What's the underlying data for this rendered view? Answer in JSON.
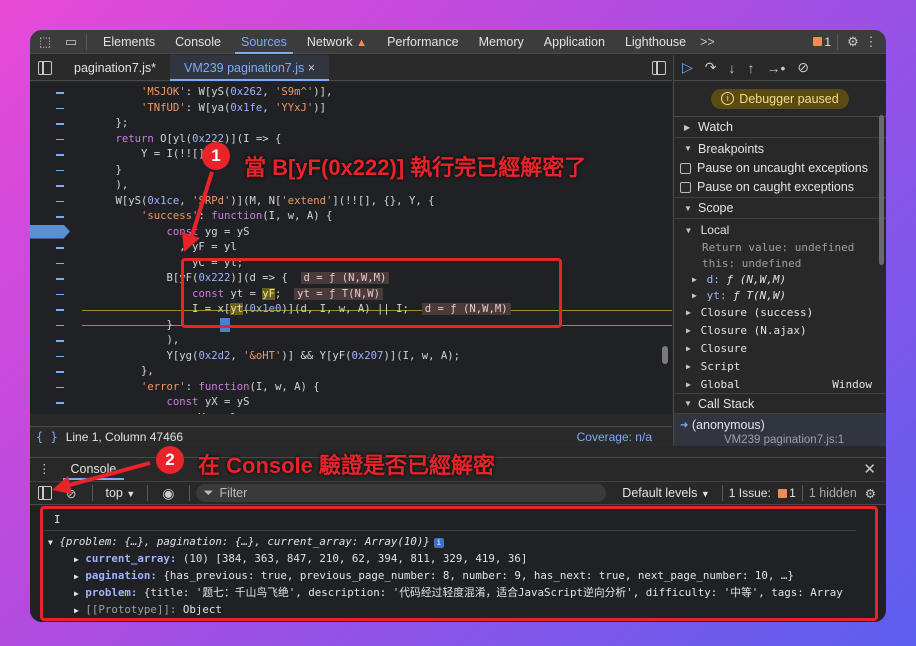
{
  "topbar": {
    "tabs": [
      "Elements",
      "Console",
      "Sources",
      "Network",
      "Performance",
      "Memory",
      "Application",
      "Lighthouse"
    ],
    "active_tab": "Sources",
    "more": ">>",
    "issues_count": "1"
  },
  "files": {
    "tab1": "pagination7.js*",
    "tab2": "VM239 pagination7.js",
    "close": "×"
  },
  "code": {
    "lines": [
      {
        "i": 0,
        "html": "        <span class='s'>'MSJOK'</span>: W[yS(<span class='n'>0x262</span>, <span class='s'>'S9m^'</span>)],"
      },
      {
        "i": 1,
        "html": "        <span class='s'>'TNfUD'</span>: W[ya(<span class='n'>0x1fe</span>, <span class='s'>'YYxJ'</span>)]"
      },
      {
        "i": 2,
        "html": "    };"
      },
      {
        "i": 3,
        "html": "    <span class='k'>return</span> O[yl(<span class='n'>0x222</span>)](I => {"
      },
      {
        "i": 4,
        "html": "        Y = I(!![], Y;"
      },
      {
        "i": 5,
        "html": "    }"
      },
      {
        "i": 6,
        "html": "    ),"
      },
      {
        "i": 7,
        "html": "    W[yS(<span class='n'>0x1ce</span>, <span class='s'>'SRPd'</span>)](M, N[<span class='s'>'extend'</span>](!![], {}, Y, {"
      },
      {
        "i": 8,
        "html": "        <span class='s'>'success'</span>: <span class='k'>function</span>(I, w, A) {"
      },
      {
        "i": 9,
        "html": "            <span class='k'>const</span> yg = yS"
      },
      {
        "i": 10,
        "html": "              , yF = yl"
      },
      {
        "i": 11,
        "html": "              , yC = yl;"
      },
      {
        "i": 12,
        "html": "            B[yF(<span class='n'>0x222</span>)](d => {  <span class='inl'>d = ƒ (N,W,M)</span>"
      },
      {
        "i": 13,
        "html": "                <span class='k'>const</span> yt = <span class='hl'>yF</span>;  <span class='inl'>yt = ƒ T(N,W)</span>"
      },
      {
        "i": 14,
        "html": "                I = x[<span class='hl'>yt</span>(<span class='n'>0x1e0</span>)](d, I, w, A) || I;  <span class='inl'>d = ƒ (N,W,M)</span>"
      },
      {
        "i": 15,
        "html": "            }"
      },
      {
        "i": 16,
        "html": "            ),"
      },
      {
        "i": 17,
        "html": "            Y[yg(<span class='n'>0x2d2</span>, <span class='s'>'&oHT'</span>)] && Y[yF(<span class='n'>0x207</span>)](I, w, A);"
      },
      {
        "i": 18,
        "html": "        },"
      },
      {
        "i": 19,
        "html": "        <span class='s'>'error'</span>: <span class='k'>function</span>(I, w, A) {"
      },
      {
        "i": 20,
        "html": "            <span class='k'>const</span> yX = yS"
      },
      {
        "i": 21,
        "html": "              , yV = yl"
      }
    ]
  },
  "status": {
    "position": "Line 1, Column 47466",
    "coverage": "Coverage: n/a"
  },
  "debugger": {
    "paused": "Debugger paused",
    "watch": "Watch",
    "breakpoints": "Breakpoints",
    "pause_uncaught": "Pause on uncaught exceptions",
    "pause_caught": "Pause on caught exceptions",
    "scope": "Scope",
    "local": "Local",
    "return_value_key": "Return value:",
    "return_value": "undefined",
    "this_key": "this:",
    "this_value": "undefined",
    "d_key": "d:",
    "d_value": "ƒ (N,W,M)",
    "yt_key": "yt:",
    "yt_value": "ƒ T(N,W)",
    "closures": [
      "Closure (success)",
      "Closure (N.ajax)",
      "Closure",
      "Script"
    ],
    "global": "Global",
    "global_value": "Window",
    "call_stack": "Call Stack",
    "anon": "(anonymous)",
    "anon_loc": "VM239 pagination7.js:1"
  },
  "console": {
    "tab": "Console",
    "context": "top",
    "filter_placeholder": "Filter",
    "levels": "Default levels",
    "issues": "1 Issue:",
    "issues_count": "1",
    "hidden": "1 hidden",
    "input": "I",
    "summary": "{problem: {…}, pagination: {…}, current_array: Array(10)}",
    "current_array_key": "current_array:",
    "current_array_value": "(10) [384, 363, 847, 210, 62, 394, 811, 329, 419, 36]",
    "pagination_key": "pagination:",
    "pagination_value": "{has_previous: true, previous_page_number: 8, number: 9, has_next: true, next_page_number: 10, …}",
    "problem_key": "problem:",
    "problem_value": "{title: '题七：千山鸟飞绝', description: '代码经过轻度混淆，适合JavaScript逆向分析', difficulty: '中等', tags: Array",
    "prototype_key": "[[Prototype]]:",
    "prototype_value": "Object"
  },
  "annotations": {
    "step1": "1",
    "step1_text": "當 B[yF(0x222)] 執行完已經解密了",
    "step2": "2",
    "step2_text": "在 Console 驗證是否已經解密"
  },
  "colors": {
    "annotation": "#e8232a",
    "accent": "#7cacf8",
    "background_gradient": [
      "#e84ad6",
      "#5b5ff0"
    ]
  }
}
